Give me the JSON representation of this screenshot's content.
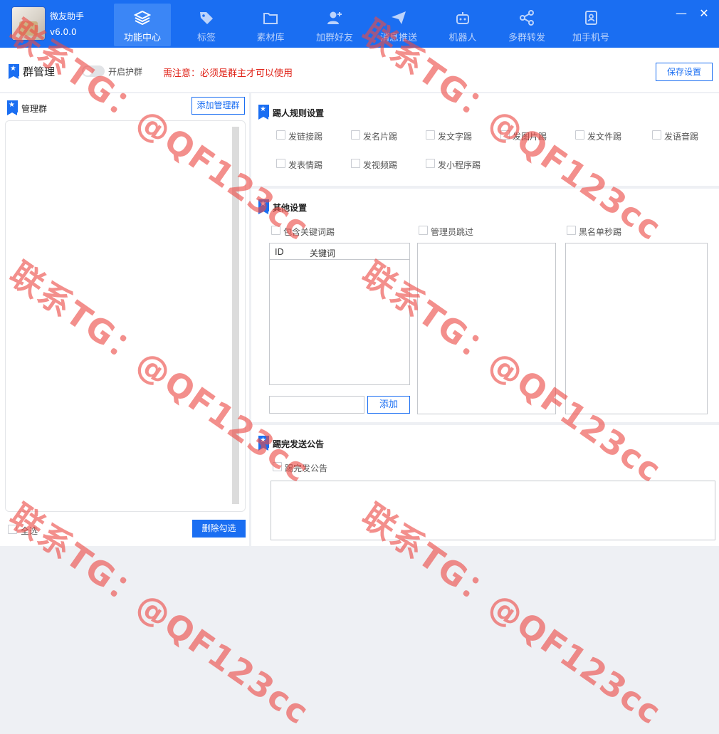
{
  "app": {
    "name": "微友助手",
    "version": "v6.0.0"
  },
  "nav": [
    {
      "label": "功能中心",
      "icon": "layers-icon",
      "active": true
    },
    {
      "label": "标签",
      "icon": "tag-icon",
      "active": false
    },
    {
      "label": "素材库",
      "icon": "folder-icon",
      "active": false
    },
    {
      "label": "加群好友",
      "icon": "add-user-icon",
      "active": false
    },
    {
      "label": "消息推送",
      "icon": "send-icon",
      "active": false
    },
    {
      "label": "机器人",
      "icon": "robot-icon",
      "active": false
    },
    {
      "label": "多群转发",
      "icon": "share-icon",
      "active": false
    },
    {
      "label": "加手机号",
      "icon": "contact-book-icon",
      "active": false
    }
  ],
  "window": {
    "minimize": "—",
    "close": "✕"
  },
  "group_mgmt": {
    "title": "群管理",
    "protect_toggle_label": "开启护群",
    "warning": "需注意：必须是群主才可以使用",
    "save_button": "保存设置"
  },
  "left_panel": {
    "title": "管理群",
    "add_button": "添加管理群",
    "select_all": "全选",
    "delete_button": "删除勾选"
  },
  "kick_rules": {
    "title": "踢人规则设置",
    "options": [
      "发链接踢",
      "发名片踢",
      "发文字踢",
      "发图片踢",
      "发文件踢",
      "发语音踢",
      "发表情踢",
      "发视频踢",
      "发小程序踢"
    ]
  },
  "other_settings": {
    "title": "其他设置",
    "keyword_kick": "包含关键词踢",
    "admin_skip": "管理员跳过",
    "blacklist_kick": "黑名单秒踢",
    "table_headers": [
      "ID",
      "关键词"
    ],
    "add_button": "添加",
    "keyword_input_placeholder": ""
  },
  "announce": {
    "title": "踢完发送公告",
    "checkbox_label": "踢完发公告"
  },
  "watermark": "联系TG：@QF123cc",
  "colors": {
    "primary": "#1a6ef2",
    "warning": "#e0241a",
    "watermark": "#eb4b46"
  }
}
